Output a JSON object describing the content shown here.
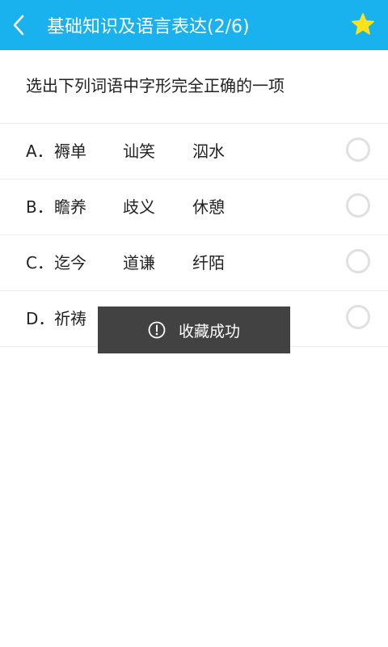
{
  "header": {
    "title": "基础知识及语言表达(2/6)",
    "back_icon": "chevron-left-icon",
    "favorite_icon": "star-icon",
    "bg_color": "#1ab2ee",
    "star_color": "#ffe21a"
  },
  "question": {
    "text": "选出下列词语中字形完全正确的一项"
  },
  "options": [
    {
      "letter": "A．",
      "words": [
        "褥单",
        "讪笑",
        "泅水"
      ]
    },
    {
      "letter": "B．",
      "words": [
        "瞻养",
        "歧义",
        "休憩"
      ]
    },
    {
      "letter": "C．",
      "words": [
        "迄今",
        "道谦",
        "纤陌"
      ]
    },
    {
      "letter": "D．",
      "words": [
        "祈祷"
      ]
    }
  ],
  "toast": {
    "icon": "info-icon",
    "text": "收藏成功"
  }
}
